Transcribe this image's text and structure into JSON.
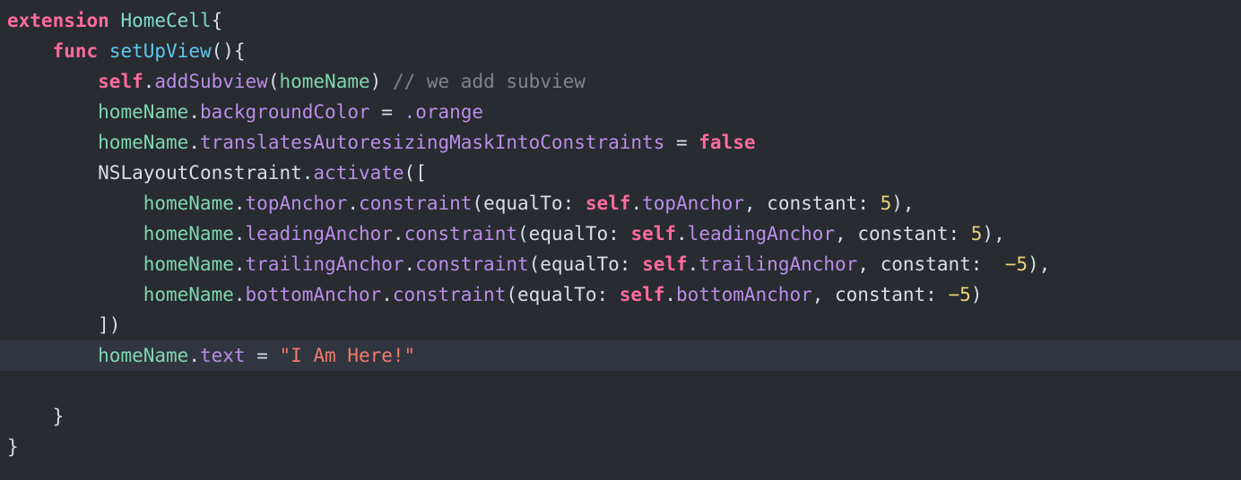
{
  "editor": {
    "language": "Swift",
    "background_color": "#282b30",
    "highlight_color": "#31353f",
    "default_text_color": "#d8dee9",
    "palette": {
      "keyword": "#ff6b9d",
      "type": "#7fdbca",
      "function": "#5fc9f0",
      "property": "#b98ee8",
      "identifier": "#7fd6b0",
      "punctuation": "#d8dee9",
      "comment": "#7f848e",
      "number": "#e8d37a",
      "string": "#f0796b"
    },
    "lines": [
      {
        "index": 0,
        "highlighted": false,
        "plain_text": "extension HomeCell{",
        "tokens": [
          {
            "t": "extension",
            "c": "keyword"
          },
          {
            "t": " ",
            "c": "plain"
          },
          {
            "t": "HomeCell",
            "c": "type"
          },
          {
            "t": "{",
            "c": "punct"
          }
        ]
      },
      {
        "index": 1,
        "highlighted": false,
        "plain_text": "    func setUpView(){",
        "tokens": [
          {
            "t": "    ",
            "c": "plain"
          },
          {
            "t": "func",
            "c": "keyword"
          },
          {
            "t": " ",
            "c": "plain"
          },
          {
            "t": "setUpView",
            "c": "func"
          },
          {
            "t": "(){",
            "c": "punct"
          }
        ]
      },
      {
        "index": 2,
        "highlighted": false,
        "plain_text": "        self.addSubview(homeName) // we add subview",
        "tokens": [
          {
            "t": "        ",
            "c": "plain"
          },
          {
            "t": "self",
            "c": "keyword"
          },
          {
            "t": ".",
            "c": "punct"
          },
          {
            "t": "addSubview",
            "c": "prop"
          },
          {
            "t": "(",
            "c": "punct"
          },
          {
            "t": "homeName",
            "c": "ident"
          },
          {
            "t": ")",
            "c": "punct"
          },
          {
            "t": " ",
            "c": "plain"
          },
          {
            "t": "// we add subview",
            "c": "comment"
          }
        ]
      },
      {
        "index": 3,
        "highlighted": false,
        "plain_text": "        homeName.backgroundColor = .orange",
        "tokens": [
          {
            "t": "        ",
            "c": "plain"
          },
          {
            "t": "homeName",
            "c": "ident"
          },
          {
            "t": ".",
            "c": "punct"
          },
          {
            "t": "backgroundColor",
            "c": "prop"
          },
          {
            "t": " = ",
            "c": "plain"
          },
          {
            "t": ".orange",
            "c": "prop"
          }
        ]
      },
      {
        "index": 4,
        "highlighted": false,
        "plain_text": "        homeName.translatesAutoresizingMaskIntoConstraints = false",
        "tokens": [
          {
            "t": "        ",
            "c": "plain"
          },
          {
            "t": "homeName",
            "c": "ident"
          },
          {
            "t": ".",
            "c": "punct"
          },
          {
            "t": "translatesAutoresizingMaskIntoConstraints",
            "c": "prop"
          },
          {
            "t": " = ",
            "c": "plain"
          },
          {
            "t": "false",
            "c": "keyword"
          }
        ]
      },
      {
        "index": 5,
        "highlighted": false,
        "plain_text": "        NSLayoutConstraint.activate([",
        "tokens": [
          {
            "t": "        ",
            "c": "plain"
          },
          {
            "t": "NSLayoutConstraint",
            "c": "plain"
          },
          {
            "t": ".",
            "c": "punct"
          },
          {
            "t": "activate",
            "c": "prop"
          },
          {
            "t": "([",
            "c": "punct"
          }
        ]
      },
      {
        "index": 6,
        "highlighted": false,
        "plain_text": "            homeName.topAnchor.constraint(equalTo: self.topAnchor, constant: 5),",
        "tokens": [
          {
            "t": "            ",
            "c": "plain"
          },
          {
            "t": "homeName",
            "c": "ident"
          },
          {
            "t": ".",
            "c": "punct"
          },
          {
            "t": "topAnchor",
            "c": "prop"
          },
          {
            "t": ".",
            "c": "punct"
          },
          {
            "t": "constraint",
            "c": "prop"
          },
          {
            "t": "(equalTo: ",
            "c": "plain"
          },
          {
            "t": "self",
            "c": "keyword"
          },
          {
            "t": ".",
            "c": "punct"
          },
          {
            "t": "topAnchor",
            "c": "prop"
          },
          {
            "t": ", constant: ",
            "c": "plain"
          },
          {
            "t": "5",
            "c": "number"
          },
          {
            "t": "),",
            "c": "punct"
          }
        ]
      },
      {
        "index": 7,
        "highlighted": false,
        "plain_text": "            homeName.leadingAnchor.constraint(equalTo: self.leadingAnchor, constant: 5),",
        "tokens": [
          {
            "t": "            ",
            "c": "plain"
          },
          {
            "t": "homeName",
            "c": "ident"
          },
          {
            "t": ".",
            "c": "punct"
          },
          {
            "t": "leadingAnchor",
            "c": "prop"
          },
          {
            "t": ".",
            "c": "punct"
          },
          {
            "t": "constraint",
            "c": "prop"
          },
          {
            "t": "(equalTo: ",
            "c": "plain"
          },
          {
            "t": "self",
            "c": "keyword"
          },
          {
            "t": ".",
            "c": "punct"
          },
          {
            "t": "leadingAnchor",
            "c": "prop"
          },
          {
            "t": ", constant: ",
            "c": "plain"
          },
          {
            "t": "5",
            "c": "number"
          },
          {
            "t": "),",
            "c": "punct"
          }
        ]
      },
      {
        "index": 8,
        "highlighted": false,
        "plain_text": "            homeName.trailingAnchor.constraint(equalTo: self.trailingAnchor, constant:  −5),",
        "tokens": [
          {
            "t": "            ",
            "c": "plain"
          },
          {
            "t": "homeName",
            "c": "ident"
          },
          {
            "t": ".",
            "c": "punct"
          },
          {
            "t": "trailingAnchor",
            "c": "prop"
          },
          {
            "t": ".",
            "c": "punct"
          },
          {
            "t": "constraint",
            "c": "prop"
          },
          {
            "t": "(equalTo: ",
            "c": "plain"
          },
          {
            "t": "self",
            "c": "keyword"
          },
          {
            "t": ".",
            "c": "punct"
          },
          {
            "t": "trailingAnchor",
            "c": "prop"
          },
          {
            "t": ", constant:  ",
            "c": "plain"
          },
          {
            "t": "−5",
            "c": "number"
          },
          {
            "t": "),",
            "c": "punct"
          }
        ]
      },
      {
        "index": 9,
        "highlighted": false,
        "plain_text": "            homeName.bottomAnchor.constraint(equalTo: self.bottomAnchor, constant: −5)",
        "tokens": [
          {
            "t": "            ",
            "c": "plain"
          },
          {
            "t": "homeName",
            "c": "ident"
          },
          {
            "t": ".",
            "c": "punct"
          },
          {
            "t": "bottomAnchor",
            "c": "prop"
          },
          {
            "t": ".",
            "c": "punct"
          },
          {
            "t": "constraint",
            "c": "prop"
          },
          {
            "t": "(equalTo: ",
            "c": "plain"
          },
          {
            "t": "self",
            "c": "keyword"
          },
          {
            "t": ".",
            "c": "punct"
          },
          {
            "t": "bottomAnchor",
            "c": "prop"
          },
          {
            "t": ", constant: ",
            "c": "plain"
          },
          {
            "t": "−5",
            "c": "number"
          },
          {
            "t": ")",
            "c": "punct"
          }
        ]
      },
      {
        "index": 10,
        "highlighted": false,
        "plain_text": "        ])",
        "tokens": [
          {
            "t": "        ",
            "c": "plain"
          },
          {
            "t": "])",
            "c": "punct"
          }
        ]
      },
      {
        "index": 11,
        "highlighted": true,
        "plain_text": "        homeName.text = \"I Am Here!\"",
        "tokens": [
          {
            "t": "        ",
            "c": "plain"
          },
          {
            "t": "homeName",
            "c": "ident"
          },
          {
            "t": ".",
            "c": "punct"
          },
          {
            "t": "text",
            "c": "prop"
          },
          {
            "t": " = ",
            "c": "plain"
          },
          {
            "t": "\"I Am Here!\"",
            "c": "string"
          }
        ]
      },
      {
        "index": 12,
        "highlighted": false,
        "plain_text": "",
        "tokens": []
      },
      {
        "index": 13,
        "highlighted": false,
        "plain_text": "    }",
        "tokens": [
          {
            "t": "    ",
            "c": "plain"
          },
          {
            "t": "}",
            "c": "punct"
          }
        ]
      },
      {
        "index": 14,
        "highlighted": false,
        "plain_text": "}",
        "tokens": [
          {
            "t": "}",
            "c": "punct"
          }
        ]
      }
    ]
  }
}
